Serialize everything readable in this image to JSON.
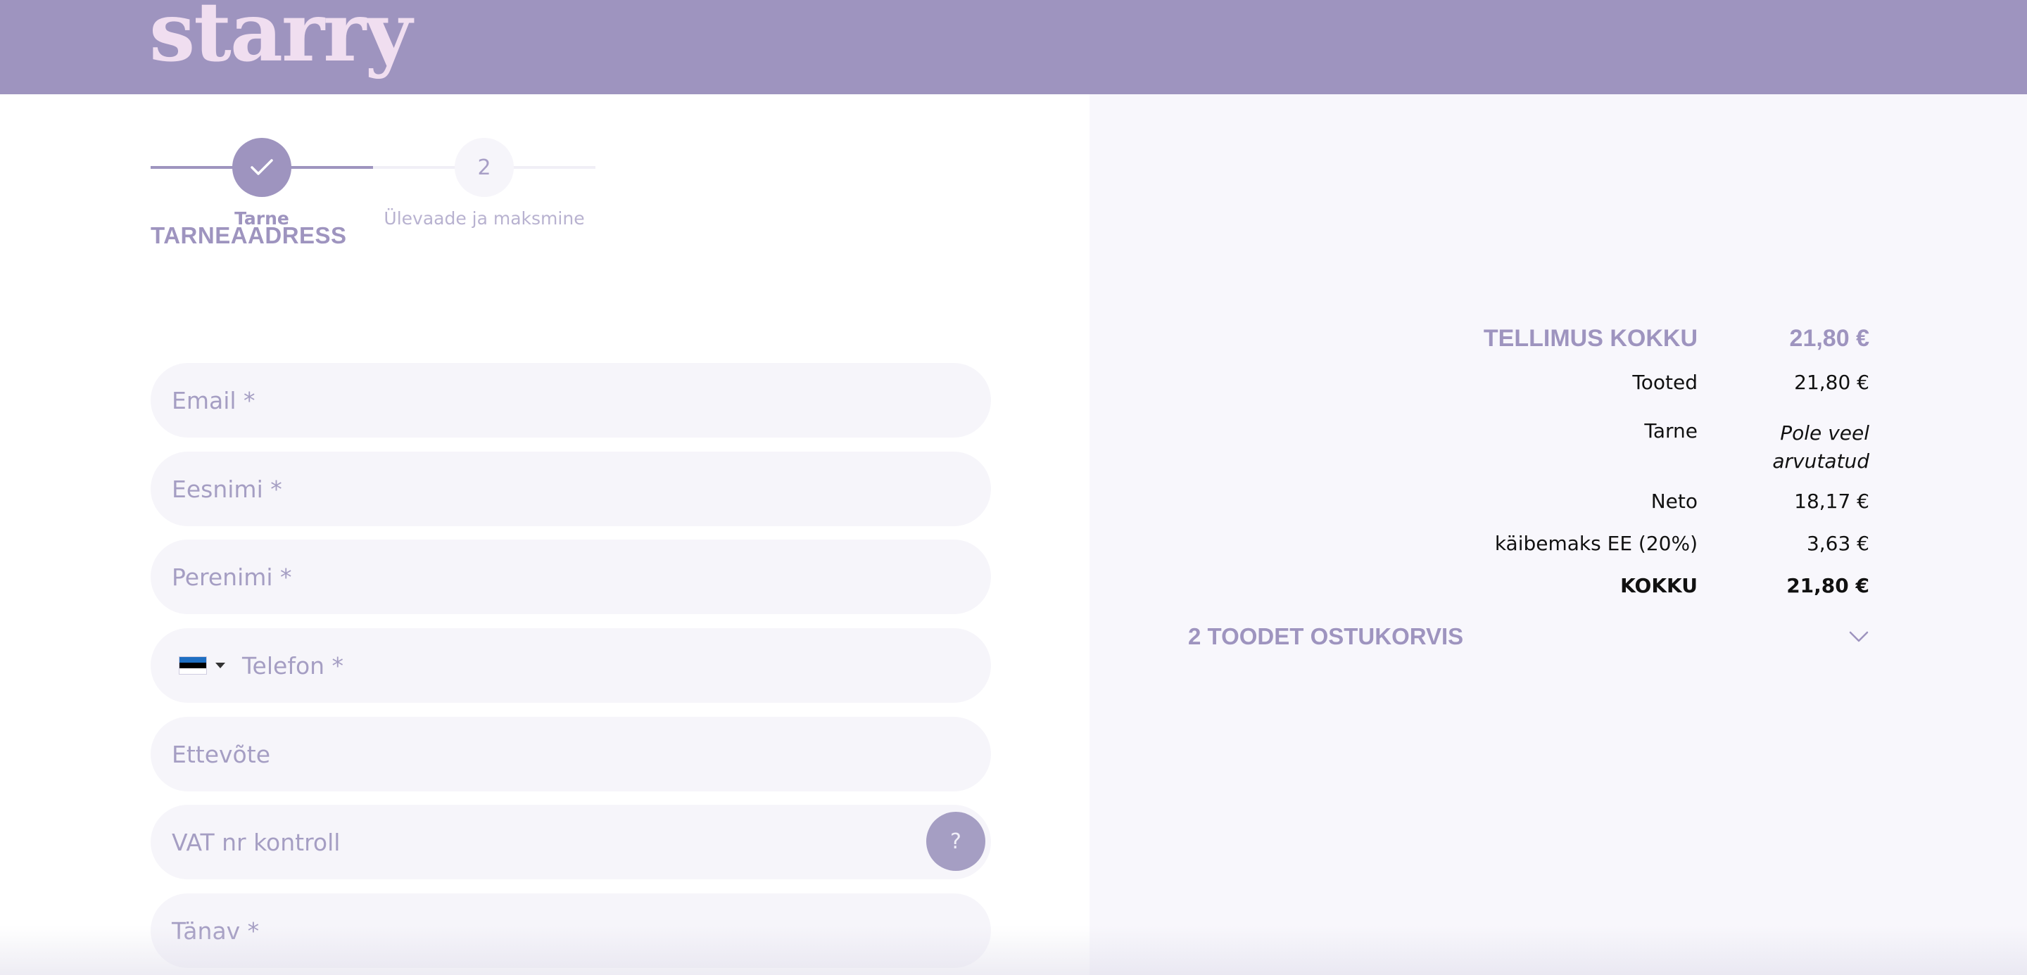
{
  "brand": {
    "logo_text": "starry"
  },
  "stepper": {
    "steps": [
      {
        "label": "Tarne",
        "state": "done"
      },
      {
        "number": "2",
        "label": "Ülevaade ja maksmine",
        "state": "todo"
      }
    ]
  },
  "form": {
    "section_title": "TARNEAADRESS",
    "fields": {
      "email": {
        "placeholder": "Email *"
      },
      "first_name": {
        "placeholder": "Eesnimi *"
      },
      "last_name": {
        "placeholder": "Perenimi *"
      },
      "phone": {
        "placeholder": "Telefon *",
        "country_flag": "flag-estonia-icon"
      },
      "company": {
        "placeholder": "Ettevõte"
      },
      "vat": {
        "placeholder": "VAT nr kontroll",
        "help_label": "?"
      },
      "street": {
        "placeholder": "Tänav *"
      }
    }
  },
  "summary": {
    "total_head": {
      "label": "TELLIMUS KOKKU",
      "value": "21,80 €"
    },
    "rows": [
      {
        "label": "Tooted",
        "value": "21,80 €"
      },
      {
        "label": "Tarne",
        "value_line1": "Pole veel",
        "value_line2": "arvutatud"
      },
      {
        "label": "Neto",
        "value": "18,17 €"
      },
      {
        "label": "käibemaks EE (20%)",
        "value": "3,63 €"
      },
      {
        "label": "KOKKU",
        "value": "21,80 €"
      }
    ],
    "cart_toggle": {
      "label": "2 TOODET OSTUKORVIS",
      "icon": "chevron-down-icon"
    }
  },
  "colors": {
    "accent": "#9e94bf",
    "logo": "#f0def0",
    "field_bg": "#f6f5fa",
    "summary_bg": "#f8f7fc"
  }
}
